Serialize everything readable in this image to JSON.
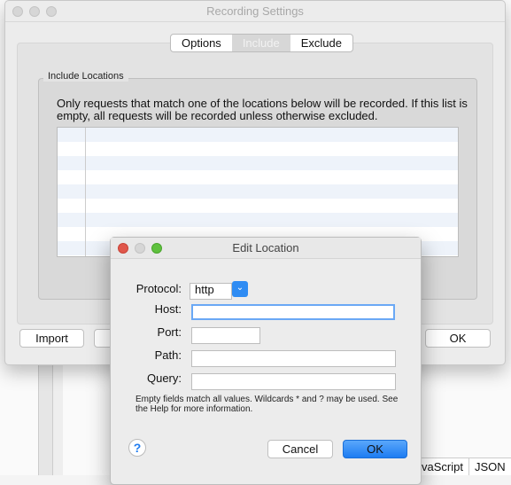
{
  "recording_settings": {
    "title": "Recording Settings",
    "tabs": [
      {
        "label": "Options"
      },
      {
        "label": "Include",
        "selected": true
      },
      {
        "label": "Exclude"
      }
    ],
    "group_label": "Include Locations",
    "description": "Only requests that match one of the locations below will be recorded. If this list is empty, all requests will be recorded unless otherwise excluded.",
    "buttons": {
      "import": "Import",
      "ok": "OK"
    }
  },
  "edit_location": {
    "title": "Edit Location",
    "protocol_label": "Protocol:",
    "protocol_value": "http",
    "host_label": "Host:",
    "host_value": "",
    "port_label": "Port:",
    "port_value": "",
    "path_label": "Path:",
    "path_value": "",
    "query_label": "Query:",
    "query_value": "",
    "note": "Empty fields match all values. Wildcards * and ? may be used. See the Help for more information.",
    "help_glyph": "?",
    "cancel": "Cancel",
    "ok": "OK"
  },
  "background_tabs": [
    "vaScript",
    "JSON"
  ],
  "colors": {
    "accent": "#1f7cf0",
    "close": "#e0574b",
    "minimize": "#cfcfcf",
    "zoom": "#5fc13e"
  }
}
